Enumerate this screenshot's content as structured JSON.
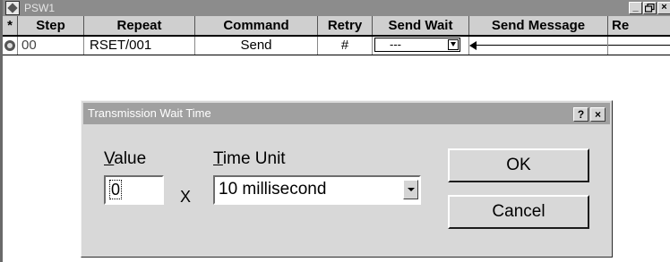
{
  "window": {
    "title": "PSW1",
    "controls": {
      "minimize": "_",
      "restore": "Ɖ",
      "close": "×"
    }
  },
  "grid": {
    "columns": [
      "*",
      "Step",
      "Repeat",
      "Command",
      "Retry",
      "Send Wait",
      "Send Message",
      "Re"
    ],
    "row": {
      "step": "00",
      "repeat": "RSET/001",
      "command": "Send",
      "retry": "#",
      "send_wait": "---"
    }
  },
  "dialog": {
    "title": "Transmission Wait Time",
    "help": "?",
    "close": "×",
    "value_label_mnemonic": "V",
    "value_label_rest": "alue",
    "value": "0",
    "multiply": "X",
    "unit_label_mnemonic": "T",
    "unit_label_rest": "ime Unit",
    "unit_selected": "10 millisecond",
    "ok_label": "OK",
    "cancel_label": "Cancel"
  }
}
